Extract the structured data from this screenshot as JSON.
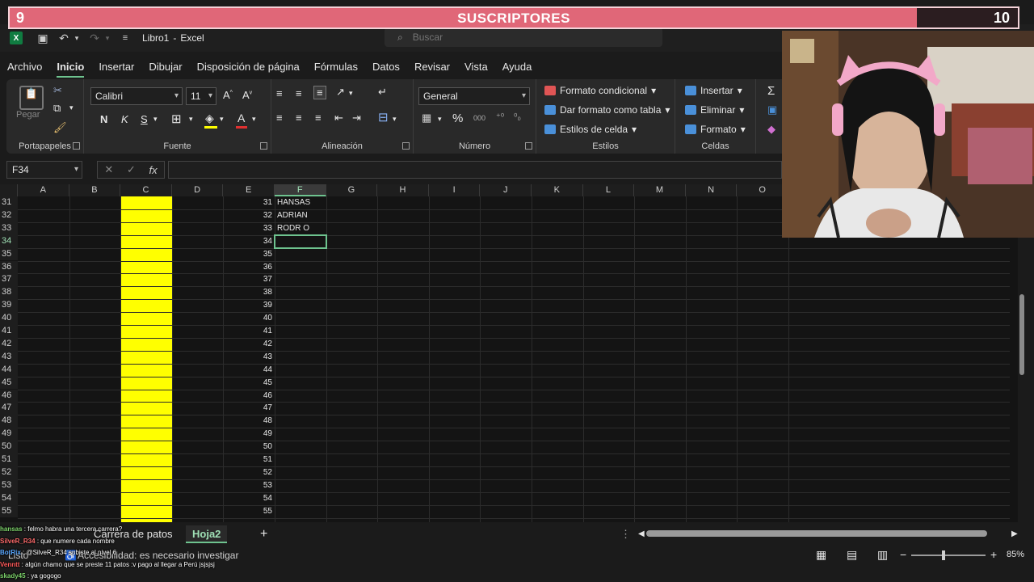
{
  "banner": {
    "left_number": "9",
    "title": "SUSCRIPTORES",
    "right_number": "10",
    "progress": 0.9
  },
  "title": {
    "filename": "Libro1",
    "separator": "-",
    "app": "Excel",
    "search_placeholder": "Buscar"
  },
  "menu": [
    "Archivo",
    "Inicio",
    "Insertar",
    "Dibujar",
    "Disposición de página",
    "Fórmulas",
    "Datos",
    "Revisar",
    "Vista",
    "Ayuda"
  ],
  "ribbon": {
    "clipboard": {
      "paste": "Pegar",
      "label": "Portapapeles"
    },
    "font": {
      "name": "Calibri",
      "size": "11",
      "bold": "N",
      "italic": "K",
      "underline": "S",
      "label": "Fuente"
    },
    "alignment": {
      "label": "Alineación"
    },
    "number": {
      "format": "General",
      "percent": "%",
      "thousands": "000",
      "label": "Número"
    },
    "styles": {
      "conditional": "Formato condicional",
      "as_table": "Dar formato como tabla",
      "cell_styles": "Estilos de celda",
      "label": "Estilos"
    },
    "cells": {
      "insert": "Insertar",
      "delete": "Eliminar",
      "format": "Formato",
      "label": "Celdas"
    }
  },
  "formula_bar": {
    "name_box": "F34",
    "fx": "fx",
    "value": ""
  },
  "grid": {
    "columns": [
      "A",
      "B",
      "C",
      "D",
      "E",
      "F",
      "G",
      "H",
      "I",
      "J",
      "K",
      "L",
      "M",
      "N",
      "O"
    ],
    "selected_column": "F",
    "rows": [
      "31",
      "32",
      "33",
      "34",
      "35",
      "36",
      "37",
      "38",
      "39",
      "40",
      "41",
      "42",
      "43",
      "44",
      "45",
      "46",
      "47",
      "48",
      "49",
      "50",
      "51",
      "52",
      "53",
      "54",
      "55"
    ],
    "selected_row": "34",
    "e_values": [
      "31",
      "32",
      "33",
      "34",
      "35",
      "36",
      "37",
      "38",
      "39",
      "40",
      "41",
      "42",
      "43",
      "44",
      "45",
      "46",
      "47",
      "48",
      "49",
      "50",
      "51",
      "52",
      "53",
      "54",
      "55"
    ],
    "f_values": [
      "HANSAS",
      "ADRIAN",
      "RODR O"
    ],
    "highlight_color": "#ffff00",
    "selection_color": "#6ec38f"
  },
  "sheets": {
    "tabs": [
      "Carrera de patos",
      "Hoja2"
    ],
    "active": "Hoja2",
    "add": "+"
  },
  "status": {
    "ready": "Listo",
    "accessibility": "Accesibilidad: es necesario investigar",
    "zoom": "85%"
  },
  "chat": [
    {
      "user": "hansas",
      "text": ": felmo habra una tercera carrera?",
      "color": "#7dd36b"
    },
    {
      "user": "SilveR_R34",
      "text": ": que numere cada nombre",
      "color": "#ff6b6b"
    },
    {
      "user": "BotRix",
      "text": ": @SilveR_R34 subiste al nivel 6",
      "color": "#5aa8ff"
    },
    {
      "user": "Venntt",
      "text": ": algún chamo que se preste 11 patos :v pago al llegar a Perú jsjsjsj",
      "color": "#ff5a5a"
    },
    {
      "user": "skady45",
      "text": ": ya gogogo",
      "color": "#7dd36b"
    }
  ]
}
